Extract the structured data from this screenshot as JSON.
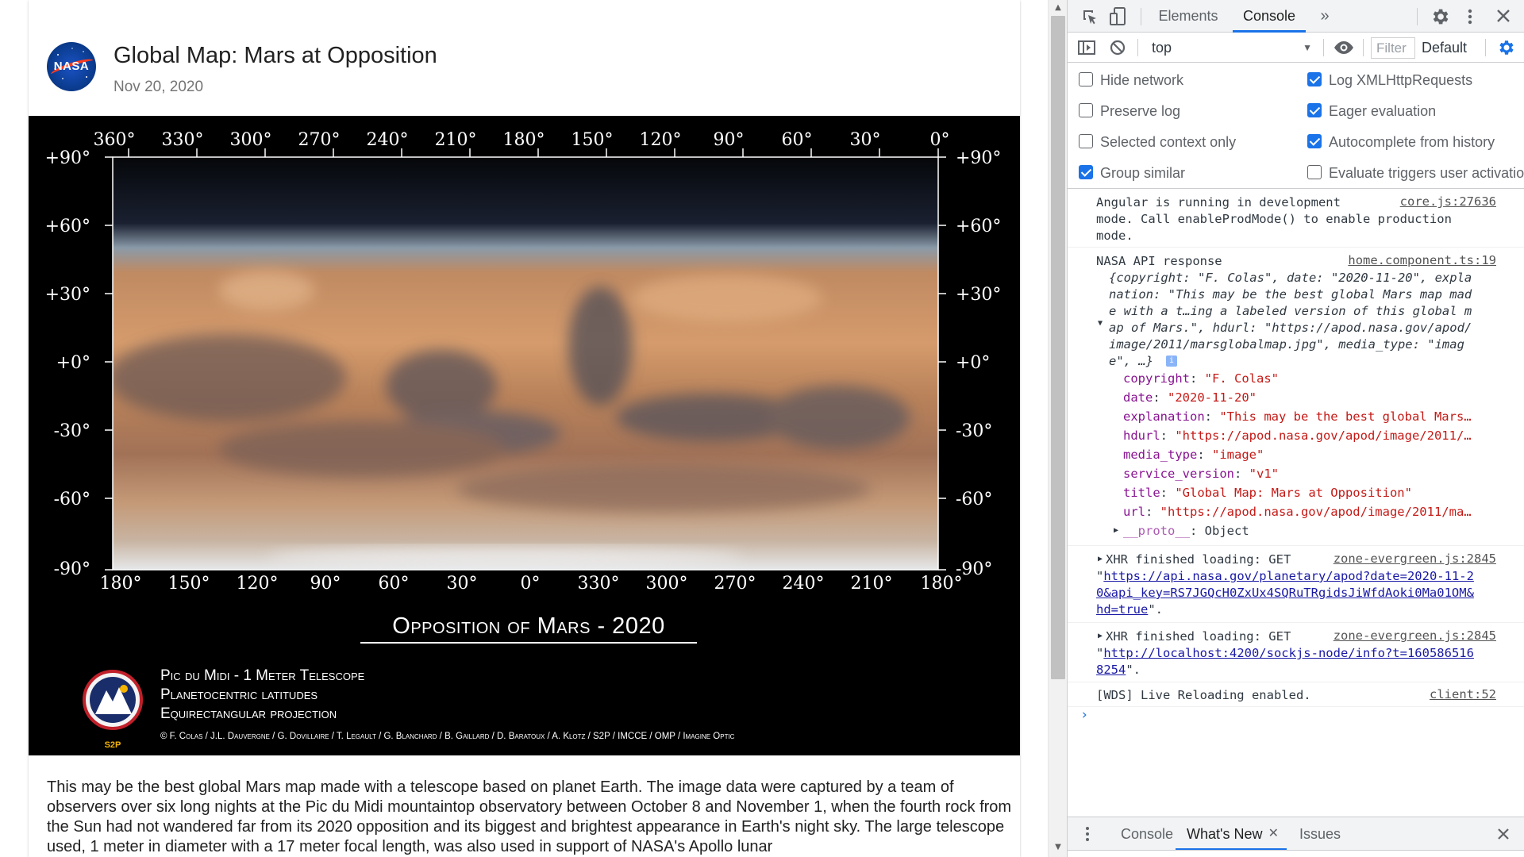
{
  "page": {
    "title": "Global Map: Mars at Opposition",
    "date": "Nov 20, 2020",
    "logo_text": "NASA",
    "description": "This may be the best global Mars map made with a telescope based on planet Earth. The image data were captured by a team of observers over six long nights at the Pic du Midi mountaintop observatory between October 8 and November 1, when the fourth rock from the Sun had not wandered far from its 2020 opposition and its biggest and brightest appearance in Earth's night sky. The large telescope used, 1 meter in diameter with a 17 meter focal length, was also used in support of NASA's Apollo lunar"
  },
  "map": {
    "top_lon_labels": [
      "360°",
      "330°",
      "300°",
      "270°",
      "240°",
      "210°",
      "180°",
      "150°",
      "120°",
      "90°",
      "60°",
      "30°",
      "0°"
    ],
    "bottom_lon_labels": [
      "180°",
      "150°",
      "120°",
      "90°",
      "60°",
      "30°",
      "0°",
      "330°",
      "300°",
      "270°",
      "240°",
      "210°",
      "180°"
    ],
    "lat_labels": [
      "+90°",
      "+60°",
      "+30°",
      "+0°",
      "-30°",
      "-60°",
      "-90°"
    ],
    "banner": "Opposition of Mars - 2020",
    "caption_lines": [
      "Pic du Midi - 1 Meter Telescope",
      "Planetocentric latitudes",
      "Equirectangular projection"
    ],
    "credits": "© F. Colas / J.L. Dauvergne / G. Dovillaire / T. Legault / G. Blanchard / B. Gaillard / D. Baratoux / A. Klotz / S2P / IMCCE / OMP / Imagine Optic",
    "badge": "S2P"
  },
  "devtools": {
    "tabs": [
      "Elements",
      "Console"
    ],
    "active_tab": "Console",
    "more_tabs": "»",
    "context": "top",
    "filter_placeholder": "Filter",
    "levels": "Default",
    "settings_left": [
      {
        "label": "Hide network",
        "checked": false
      },
      {
        "label": "Preserve log",
        "checked": false
      },
      {
        "label": "Selected context only",
        "checked": false
      },
      {
        "label": "Group similar",
        "checked": true
      }
    ],
    "settings_right": [
      {
        "label": "Log XMLHttpRequests",
        "checked": true
      },
      {
        "label": "Eager evaluation",
        "checked": true
      },
      {
        "label": "Autocomplete from history",
        "checked": true
      },
      {
        "label": "Evaluate triggers user activation",
        "checked": false
      }
    ],
    "messages": {
      "angular": {
        "lines": [
          "Angular is running in development",
          "mode. Call enableProdMode() to enable production",
          "mode."
        ],
        "source": "core.js:27636"
      },
      "nasa": {
        "label": "NASA API response",
        "source": "home.component.ts:19",
        "preview_lines": [
          "{copyright: \"F. Colas\", date: \"2020-11-20\", expla",
          "nation: \"This may be the best global Mars map mad",
          "e with a t…ing a labeled version of this global m",
          "ap of Mars.\", hdurl: \"https://apod.nasa.gov/apod/",
          "image/2011/marsglobalmap.jpg\", media_type: \"imag",
          "e\", …}"
        ],
        "props": [
          {
            "key": "copyright",
            "value": "\"F. Colas\""
          },
          {
            "key": "date",
            "value": "\"2020-11-20\""
          },
          {
            "key": "explanation",
            "value": "\"This may be the best global Mars…"
          },
          {
            "key": "hdurl",
            "value": "\"https://apod.nasa.gov/apod/image/2011/…"
          },
          {
            "key": "media_type",
            "value": "\"image\""
          },
          {
            "key": "service_version",
            "value": "\"v1\""
          },
          {
            "key": "title",
            "value": "\"Global Map: Mars at Opposition\""
          },
          {
            "key": "url",
            "value": "\"https://apod.nasa.gov/apod/image/2011/ma…"
          }
        ],
        "proto": "__proto__",
        "proto_value": ": Object"
      },
      "xhr1": {
        "label": "XHR finished loading: GET",
        "source": "zone-evergreen.js:2845",
        "url_lines": [
          "https://api.nasa.gov/planetary/apod?date=2020-11-2",
          "0&api_key=RS7JGQcH0ZxUx4SQRuTRgidsJiWfdAoki0Ma01OM&",
          "hd=true"
        ]
      },
      "xhr2": {
        "label": "XHR finished loading: GET",
        "source": "zone-evergreen.js:2845",
        "url_lines": [
          "http://localhost:4200/sockjs-node/info?t=160586516",
          "8254"
        ]
      },
      "wds": {
        "text": "[WDS] Live Reloading enabled.",
        "source": "client:52"
      }
    },
    "drawer_tabs": [
      "Console",
      "What's New",
      "Issues"
    ],
    "drawer_active": "What's New"
  }
}
